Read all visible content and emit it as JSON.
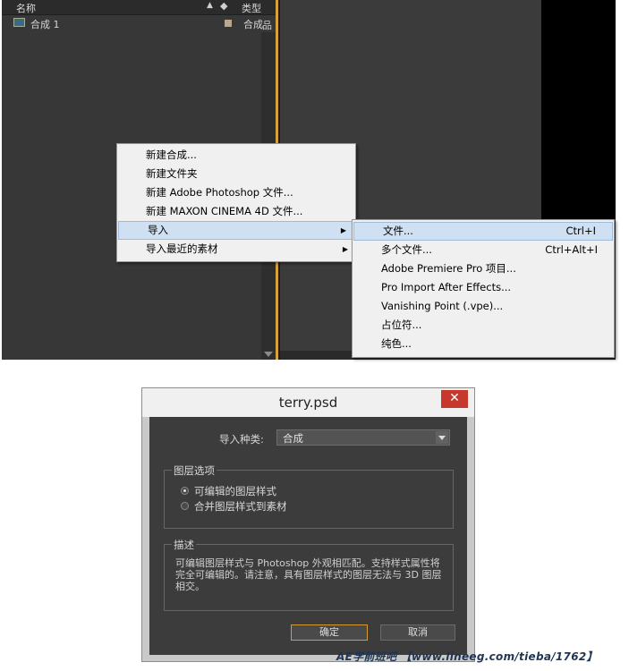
{
  "project_panel": {
    "header_name": "名称",
    "header_type": "类型",
    "item_name": "合成 1",
    "item_type": "合成"
  },
  "context_menu": {
    "items": [
      {
        "label": "新建合成..."
      },
      {
        "label": "新建文件夹"
      },
      {
        "label": "新建 Adobe Photoshop 文件..."
      },
      {
        "label": "新建 MAXON CINEMA 4D 文件..."
      },
      {
        "label": "导入"
      },
      {
        "label": "导入最近的素材"
      }
    ]
  },
  "import_submenu": {
    "items": [
      {
        "label": "文件...",
        "shortcut": "Ctrl+I"
      },
      {
        "label": "多个文件...",
        "shortcut": "Ctrl+Alt+I"
      },
      {
        "label": "Adobe Premiere Pro 项目..."
      },
      {
        "label": "Pro Import After Effects..."
      },
      {
        "label": "Vanishing Point (.vpe)..."
      },
      {
        "label": "占位符..."
      },
      {
        "label": "纯色..."
      }
    ]
  },
  "dialog": {
    "title": "terry.psd",
    "close_glyph": "✕",
    "import_kind_label": "导入种类:",
    "import_kind_value": "合成",
    "layer_options_title": "图层选项",
    "option_editable": "可编辑的图层样式",
    "option_merge": "合并图层样式到素材",
    "description_title": "描述",
    "description_text": "可编辑图层样式与 Photoshop 外观相匹配。支持样式属性将完全可编辑的。请注意，具有图层样式的图层无法与 3D 图层相交。",
    "ok_label": "确定",
    "cancel_label": "取消"
  },
  "watermark": "AE学前班吧 【www.lineeg.com/tieba/1762】"
}
